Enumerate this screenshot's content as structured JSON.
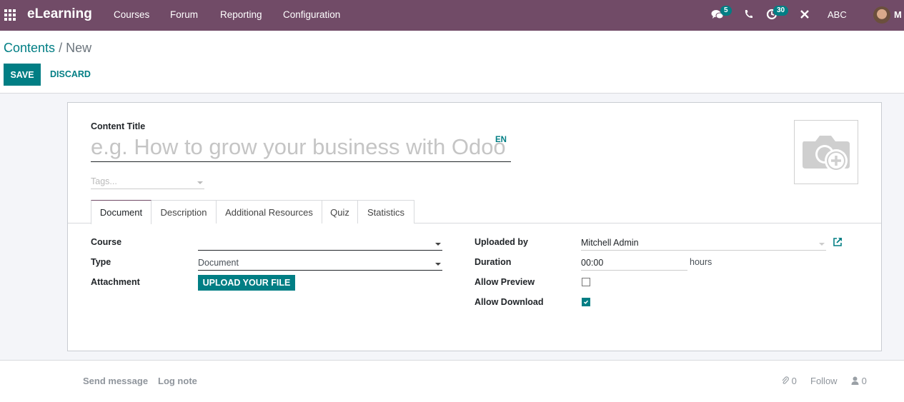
{
  "navbar": {
    "app_name": "eLearning",
    "menus": [
      "Courses",
      "Forum",
      "Reporting",
      "Configuration"
    ],
    "messages_badge": "5",
    "activities_badge": "30",
    "company": "ABC",
    "user_initial": "M",
    "icons": [
      "apps-grid-icon",
      "chat-icon",
      "phone-icon",
      "activity-clock-icon",
      "debug-tools-icon"
    ],
    "color": "#714B67"
  },
  "breadcrumb": {
    "parent": "Contents",
    "separator": "/",
    "current": "New"
  },
  "toolbar": {
    "save_label": "SAVE",
    "discard_label": "DISCARD"
  },
  "form": {
    "title_label": "Content Title",
    "title_placeholder": "e.g. How to grow your business with Odoo",
    "title_value": "",
    "lang": "EN",
    "tags_placeholder": "Tags...",
    "tabs": [
      {
        "label": "Document",
        "active": true
      },
      {
        "label": "Description",
        "active": false
      },
      {
        "label": "Additional Resources",
        "active": false
      },
      {
        "label": "Quiz",
        "active": false
      },
      {
        "label": "Statistics",
        "active": false
      }
    ],
    "left": {
      "course_label": "Course",
      "course_value": "",
      "type_label": "Type",
      "type_value": "Document",
      "attachment_label": "Attachment",
      "upload_label": "UPLOAD YOUR FILE"
    },
    "right": {
      "uploaded_by_label": "Uploaded by",
      "uploaded_by_value": "Mitchell Admin",
      "duration_label": "Duration",
      "duration_value": "00:00",
      "duration_unit": "hours",
      "allow_preview_label": "Allow Preview",
      "allow_preview": false,
      "allow_download_label": "Allow Download",
      "allow_download": true
    }
  },
  "chatter": {
    "send_message": "Send message",
    "log_note": "Log note",
    "attachments_count": "0",
    "follow": "Follow",
    "followers_count": "0"
  },
  "accent_color": "#017e84"
}
